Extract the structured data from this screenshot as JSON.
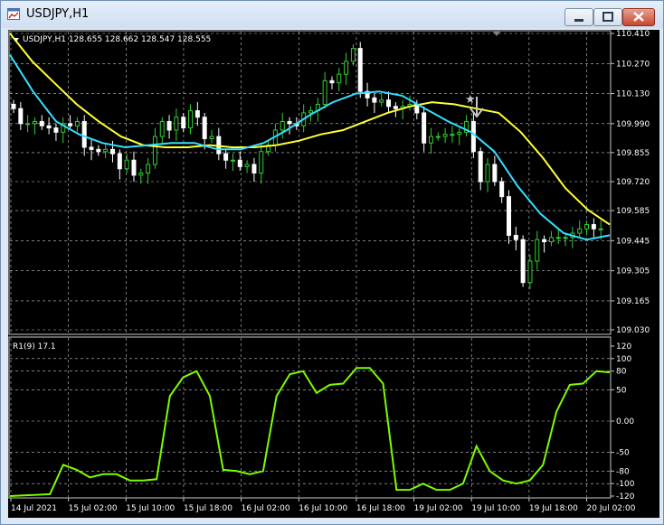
{
  "window": {
    "title": "USDJPY,H1"
  },
  "main_chart": {
    "header": "USDJPY,H1  128.655 128.662 128.547 128.555",
    "price_ticks": [
      "110.410",
      "110.270",
      "110.130",
      "109.990",
      "109.855",
      "109.720",
      "109.585",
      "109.445",
      "109.305",
      "109.165",
      "109.030"
    ],
    "price_min": 109.03,
    "price_max": 110.41,
    "grid": true,
    "colors": {
      "background": "#000000",
      "grid": "#c8c8c8",
      "bull": "#32cd32",
      "bear": "#ffffff",
      "ma_slow": "#ffff33",
      "ma_fast": "#33e0ff",
      "arrow": "#c8c8c8"
    },
    "sell_arrow_label": "★"
  },
  "sub_chart": {
    "header": "R1(9) 17.1",
    "ticks": [
      "120",
      "100",
      "80",
      "50",
      "0.00",
      "-50",
      "-80",
      "-100",
      "-120"
    ],
    "tick_values": [
      120,
      100,
      80,
      50,
      0,
      -50,
      -80,
      -100,
      -120
    ],
    "color": "#7cfc00"
  },
  "time_axis": [
    "14 Jul 2021",
    "15 Jul 02:00",
    "15 Jul 10:00",
    "15 Jul 18:00",
    "16 Jul 02:00",
    "16 Jul 10:00",
    "16 Jul 18:00",
    "19 Jul 02:00",
    "19 Jul 10:00",
    "19 Jul 18:00",
    "20 Jul 02:00"
  ],
  "chart_data": {
    "type": "line",
    "candles_close": [
      110.06,
      109.99,
      109.99,
      110.0,
      109.98,
      109.97,
      109.95,
      109.99,
      109.98,
      110.0,
      109.88,
      109.87,
      109.86,
      109.87,
      109.85,
      109.78,
      109.82,
      109.75,
      109.76,
      109.8,
      109.93,
      110.0,
      109.96,
      110.02,
      109.97,
      110.05,
      110.02,
      109.92,
      109.93,
      109.85,
      109.82,
      109.82,
      109.79,
      109.8,
      109.76,
      109.86,
      109.89,
      109.96,
      110.0,
      109.99,
      109.98,
      110.04,
      110.05,
      110.08,
      110.19,
      110.18,
      110.22,
      110.28,
      110.34,
      110.14,
      110.11,
      110.09,
      110.1,
      110.07,
      110.06,
      110.07,
      110.08,
      110.04,
      109.9,
      109.93,
      109.93,
      109.94,
      109.94,
      109.95,
      110.0,
      109.86,
      109.72,
      109.8,
      109.72,
      109.65,
      109.47,
      109.45,
      109.25,
      109.35,
      109.45,
      109.44,
      109.46,
      109.46,
      109.46,
      109.48,
      109.5,
      109.52,
      109.5,
      109.5
    ],
    "ma_slow": [
      110.41,
      110.28,
      110.18,
      110.08,
      110.0,
      109.93,
      109.89,
      109.88,
      109.88,
      109.89,
      109.88,
      109.88,
      109.89,
      109.91,
      109.94,
      109.96,
      110.0,
      110.04,
      110.07,
      110.09,
      110.08,
      110.06,
      110.04,
      109.95,
      109.83,
      109.69,
      109.59,
      109.52
    ],
    "ma_fast": [
      110.31,
      110.14,
      110.0,
      109.94,
      109.9,
      109.88,
      109.89,
      109.9,
      109.9,
      109.87,
      109.87,
      109.9,
      109.96,
      110.03,
      110.09,
      110.13,
      110.14,
      110.12,
      110.06,
      110.0,
      109.95,
      109.86,
      109.7,
      109.57,
      109.48,
      109.45,
      109.47
    ],
    "oscillator": [
      -120,
      -119,
      -118,
      -117,
      -70,
      -78,
      -90,
      -85,
      -85,
      -95,
      -95,
      -93,
      40,
      70,
      80,
      40,
      -78,
      -80,
      -85,
      -80,
      40,
      75,
      80,
      45,
      58,
      60,
      85,
      85,
      60,
      -110,
      -110,
      -100,
      -110,
      -110,
      -100,
      -40,
      -80,
      -95,
      -100,
      -95,
      -70,
      15,
      58,
      60,
      80,
      78
    ]
  }
}
